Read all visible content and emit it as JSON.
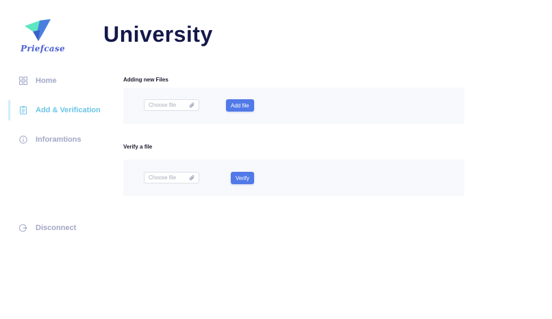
{
  "brand": {
    "name": "Priefcase"
  },
  "page": {
    "title": "University"
  },
  "sidebar": {
    "items": [
      {
        "label": "Home",
        "icon": "grid-icon",
        "active": false
      },
      {
        "label": "Add & Verification",
        "icon": "clipboard-icon",
        "active": true
      },
      {
        "label": "Inforamtions",
        "icon": "info-icon",
        "active": false
      }
    ],
    "disconnect": {
      "label": "Disconnect",
      "icon": "logout-icon"
    }
  },
  "add_section": {
    "title": "Adding new Files",
    "file_placeholder": "Choose file",
    "button_label": "Add file"
  },
  "verify_section": {
    "title": "Verify a file",
    "file_placeholder": "Choose file",
    "button_label": "Verify"
  },
  "colors": {
    "accent": "#5179e8",
    "active_nav": "#6ac4e8",
    "nav_text": "#a2a7c6",
    "title": "#14184a"
  }
}
